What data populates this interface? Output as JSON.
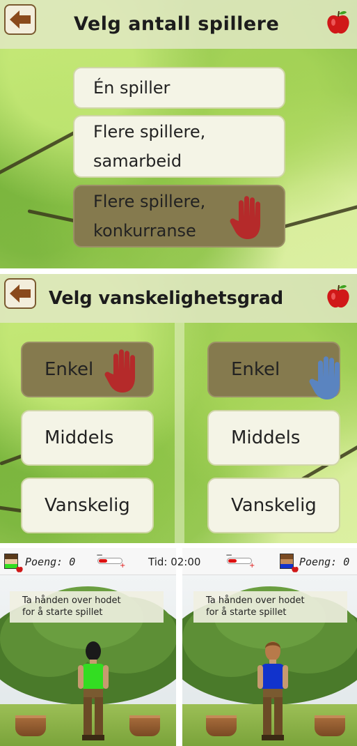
{
  "screen1": {
    "title": "Velg antall spillere",
    "options": [
      {
        "label_lines": [
          "Én spiller"
        ],
        "selected": false
      },
      {
        "label_lines": [
          "Flere spillere,",
          "samarbeid"
        ],
        "selected": false
      },
      {
        "label_lines": [
          "Flere spillere,",
          "konkurranse"
        ],
        "selected": true,
        "cursor": "red-hand-icon"
      }
    ]
  },
  "screen2": {
    "title": "Velg vanskelighetsgrad",
    "left_options": [
      {
        "label": "Enkel",
        "selected": true,
        "cursor": "red-hand-icon"
      },
      {
        "label": "Middels",
        "selected": false
      },
      {
        "label": "Vanskelig",
        "selected": false
      }
    ],
    "right_options": [
      {
        "label": "Enkel",
        "selected": true,
        "cursor": "blue-hand-icon"
      },
      {
        "label": "Middels",
        "selected": false
      },
      {
        "label": "Vanskelig",
        "selected": false
      }
    ]
  },
  "screen3": {
    "left_score": "Poeng: 0",
    "time": "Tid: 02:00",
    "right_score": "Poeng: 0",
    "left_message": [
      "Ta hånden over hodet",
      "for å starte spillet"
    ],
    "right_message": [
      "Ta hånden over hodet",
      "for å starte spillet"
    ],
    "left_shirt_color": "#33dd22",
    "right_shirt_color": "#1133cc"
  },
  "colors": {
    "selected_option": "#857a4e",
    "option_bg": "#f4f4e6",
    "back_arrow": "#8a4a1c",
    "red_hand": "#b52a2a",
    "blue_hand": "#5a84c0",
    "apple": "#d01818"
  }
}
